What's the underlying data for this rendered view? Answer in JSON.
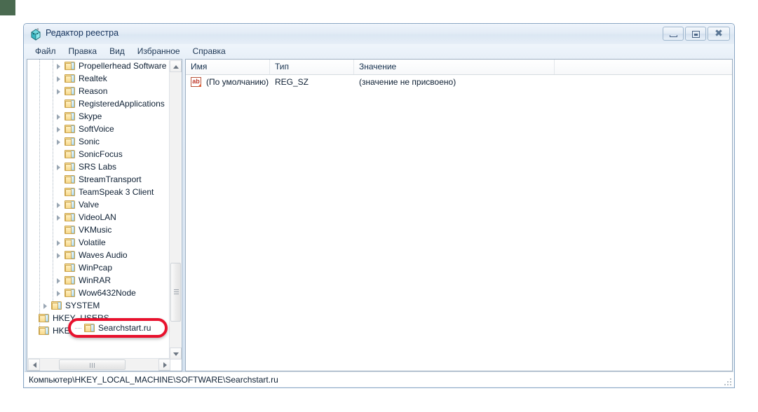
{
  "window": {
    "title": "Редактор реестра",
    "icon": "regedit-icon",
    "buttons": {
      "minimize": "Свернуть",
      "restore": "Развернуть",
      "close": "Закрыть"
    }
  },
  "menu": {
    "items": [
      {
        "label": "Файл"
      },
      {
        "label": "Правка"
      },
      {
        "label": "Вид"
      },
      {
        "label": "Избранное"
      },
      {
        "label": "Справка"
      }
    ]
  },
  "tree": {
    "items": [
      {
        "label": "Propellerhead Software",
        "depth": 2,
        "expandable": true
      },
      {
        "label": "Realtek",
        "depth": 2,
        "expandable": true
      },
      {
        "label": "Reason",
        "depth": 2,
        "expandable": true
      },
      {
        "label": "RegisteredApplications",
        "depth": 2,
        "expandable": false
      },
      {
        "label": "Skype",
        "depth": 2,
        "expandable": true
      },
      {
        "label": "SoftVoice",
        "depth": 2,
        "expandable": true
      },
      {
        "label": "Sonic",
        "depth": 2,
        "expandable": true
      },
      {
        "label": "SonicFocus",
        "depth": 2,
        "expandable": false
      },
      {
        "label": "SRS Labs",
        "depth": 2,
        "expandable": true
      },
      {
        "label": "StreamTransport",
        "depth": 2,
        "expandable": false
      },
      {
        "label": "TeamSpeak 3 Client",
        "depth": 2,
        "expandable": false
      },
      {
        "label": "Valve",
        "depth": 2,
        "expandable": true
      },
      {
        "label": "VideoLAN",
        "depth": 2,
        "expandable": true
      },
      {
        "label": "VKMusic",
        "depth": 2,
        "expandable": false
      },
      {
        "label": "Volatile",
        "depth": 2,
        "expandable": true
      },
      {
        "label": "Waves Audio",
        "depth": 2,
        "expandable": true
      },
      {
        "label": "WinPcap",
        "depth": 2,
        "expandable": false
      },
      {
        "label": "WinRAR",
        "depth": 2,
        "expandable": true
      },
      {
        "label": "Wow6432Node",
        "depth": 2,
        "expandable": true
      },
      {
        "label": "SYSTEM",
        "depth": 1,
        "expandable": true
      },
      {
        "label": "HKEY_USERS",
        "depth": 0,
        "expandable": false
      },
      {
        "label": "HKEY_CURRENT_CONFIG",
        "depth": 0,
        "expandable": false
      }
    ],
    "selected": "Searchstart.ru"
  },
  "annotation": {
    "label": "Searchstart.ru",
    "color": "#e8112d",
    "shape": "rounded-rectangle"
  },
  "list": {
    "columns": [
      "Имя",
      "Тип",
      "Значение"
    ],
    "rows": [
      {
        "icon": "string-value-icon",
        "name": "(По умолчанию)",
        "type": "REG_SZ",
        "value": "(значение не присвоено)"
      }
    ]
  },
  "status": {
    "path": "Компьютер\\HKEY_LOCAL_MACHINE\\SOFTWARE\\Searchstart.ru"
  }
}
